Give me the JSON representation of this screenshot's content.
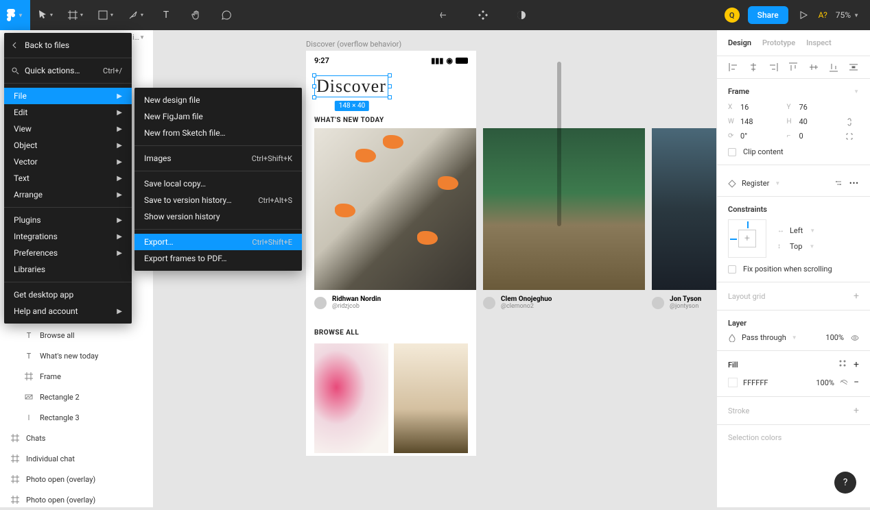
{
  "toolbar": {
    "avatar_initial": "Q",
    "share_label": "Share",
    "a_badge": "A?",
    "zoom": "75%"
  },
  "menu_main": {
    "back": "Back to files",
    "quick": "Quick actions…",
    "quick_shortcut": "Ctrl+/",
    "file": "File",
    "edit": "Edit",
    "view": "View",
    "object": "Object",
    "vector": "Vector",
    "text": "Text",
    "arrange": "Arrange",
    "plugins": "Plugins",
    "integrations": "Integrations",
    "preferences": "Preferences",
    "libraries": "Libraries",
    "desktop": "Get desktop app",
    "help": "Help and account"
  },
  "menu_sub": {
    "new_design": "New design file",
    "new_figjam": "New FigJam file",
    "new_sketch": "New from Sketch file…",
    "images": "Images",
    "images_shortcut": "Ctrl+Shift+K",
    "save_local": "Save local copy…",
    "save_history": "Save to version history…",
    "save_history_shortcut": "Ctrl+Alt+S",
    "show_history": "Show version history",
    "export": "Export…",
    "export_shortcut": "Ctrl+Shift+E",
    "export_pdf": "Export frames to PDF…"
  },
  "layers": {
    "browse_all": "Browse all",
    "whats_new": "What's new today",
    "frame": "Frame",
    "rect2": "Rectangle 2",
    "rect3": "Rectangle 3",
    "chats": "Chats",
    "individual": "Individual chat",
    "photo1": "Photo open (overlay)",
    "photo2": "Photo open (overlay)",
    "truncated": "i…"
  },
  "canvas": {
    "frame_label": "Discover (overflow behavior)",
    "time": "9:27",
    "discover": "Discover",
    "size_badge": "148 × 40",
    "whats_new": "WHAT'S NEW TODAY",
    "browse_all": "BROWSE ALL",
    "authors": [
      {
        "name": "Ridhwan Nordin",
        "handle": "@ridzjcob"
      },
      {
        "name": "Clem Onojeghuo",
        "handle": "@clemono2"
      },
      {
        "name": "Jon Tyson",
        "handle": "@jontyson"
      }
    ]
  },
  "rp": {
    "tabs": {
      "design": "Design",
      "prototype": "Prototype",
      "inspect": "Inspect"
    },
    "frame": "Frame",
    "x_lbl": "X",
    "x": "16",
    "y_lbl": "Y",
    "y": "76",
    "w_lbl": "W",
    "w": "148",
    "h_lbl": "H",
    "h": "40",
    "rot": "0°",
    "rad": "0",
    "clip": "Clip content",
    "register": "Register",
    "constraints": "Constraints",
    "left": "Left",
    "top": "Top",
    "fix": "Fix position when scrolling",
    "layout_grid": "Layout grid",
    "layer": "Layer",
    "pass_through": "Pass through",
    "opacity": "100%",
    "fill": "Fill",
    "fill_hex": "FFFFFF",
    "fill_op": "100%",
    "stroke": "Stroke",
    "selection_colors": "Selection colors"
  },
  "help": "?"
}
